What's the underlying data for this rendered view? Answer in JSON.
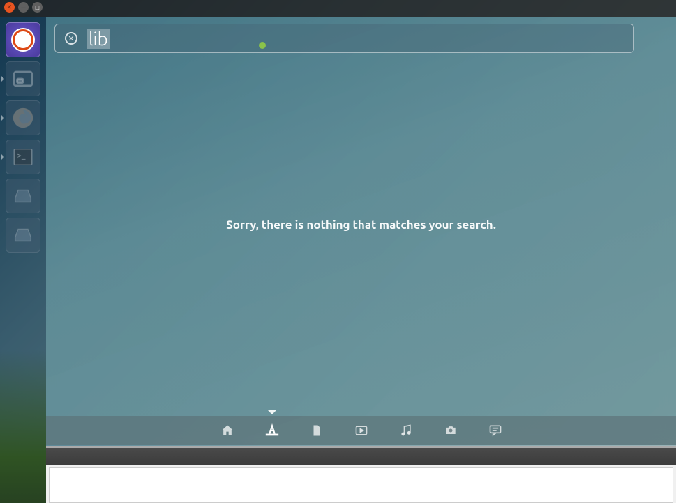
{
  "window_controls": {
    "close": "✕",
    "minimize": "─",
    "maximize": "□"
  },
  "search": {
    "query": "lib",
    "clear_symbol": "✕"
  },
  "results": {
    "no_results_message": "Sorry, there is nothing that matches your search."
  },
  "launcher": {
    "items": [
      {
        "name": "dash",
        "running": false
      },
      {
        "name": "files",
        "running": true
      },
      {
        "name": "firefox",
        "running": true
      },
      {
        "name": "terminal",
        "running": true
      },
      {
        "name": "drive1",
        "running": false
      },
      {
        "name": "drive2",
        "running": false
      }
    ]
  },
  "lenses": [
    {
      "name": "home",
      "active": false
    },
    {
      "name": "applications",
      "active": true
    },
    {
      "name": "files",
      "active": false
    },
    {
      "name": "video",
      "active": false
    },
    {
      "name": "music",
      "active": false
    },
    {
      "name": "photos",
      "active": false
    },
    {
      "name": "social",
      "active": false
    }
  ]
}
